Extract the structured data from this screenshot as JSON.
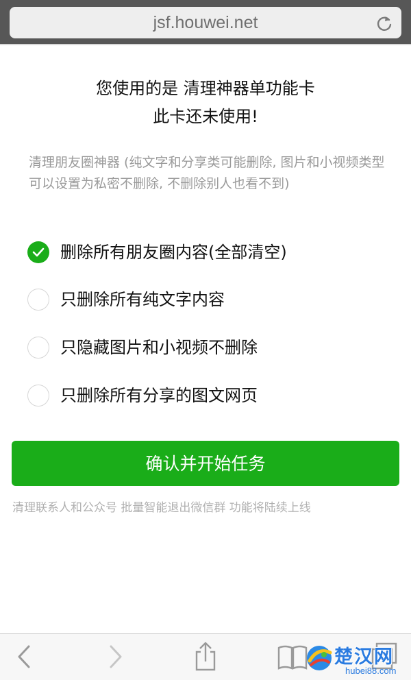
{
  "browser": {
    "url": "jsf.houwei.net"
  },
  "header": {
    "line1": "您使用的是 清理神器单功能卡",
    "line2": "此卡还未使用!"
  },
  "description": "清理朋友圈神器 (纯文字和分享类可能删除, 图片和小视频类型可以设置为私密不删除, 不删除别人也看不到)",
  "options": [
    {
      "label": "删除所有朋友圈内容(全部清空)",
      "checked": true
    },
    {
      "label": "只删除所有纯文字内容",
      "checked": false
    },
    {
      "label": "只隐藏图片和小视频不删除",
      "checked": false
    },
    {
      "label": "只删除所有分享的图文网页",
      "checked": false
    }
  ],
  "confirm_button": "确认并开始任务",
  "footnote": "清理联系人和公众号 批量智能退出微信群 功能将陆续上线",
  "toolbar_icons": [
    "back-icon",
    "forward-icon",
    "share-icon",
    "bookmarks-icon",
    "tabs-icon"
  ],
  "watermark": {
    "text_cn": "楚汉网",
    "text_en": "hubei88.com"
  },
  "colors": {
    "accent": "#1aad19",
    "topbar": "#575757",
    "muted_text": "#9a9a9a"
  }
}
